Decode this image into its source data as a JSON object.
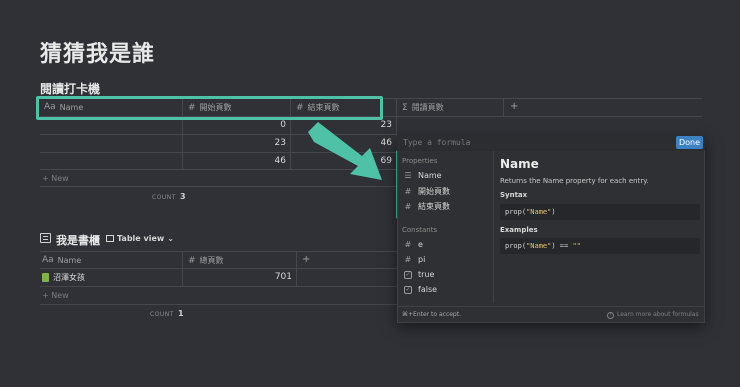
{
  "page": {
    "title": "猜猜我是誰"
  },
  "table1": {
    "title": "閱讀打卡機",
    "headers": {
      "name": "Name",
      "start": "開始頁數",
      "end": "結束頁數",
      "formula": "閱讀頁數",
      "add": "+"
    },
    "header_icons": {
      "name": "Aa",
      "num": "#",
      "formula": "Σ"
    },
    "rows": [
      {
        "start": "0",
        "end": "23"
      },
      {
        "start": "23",
        "end": "46"
      },
      {
        "start": "46",
        "end": "69"
      }
    ],
    "new_label": "+ New",
    "count_label": "COUNT",
    "count_value": "3"
  },
  "table2": {
    "icon": "book-icon",
    "title": "我是書櫃",
    "view": "Table view",
    "headers": {
      "name": "Name",
      "total": "總頁數",
      "add": "+"
    },
    "header_icons": {
      "name": "Aa",
      "num": "#"
    },
    "rows": [
      {
        "name": "沼澤女孩",
        "total": "701"
      }
    ],
    "new_label": "+ New",
    "count_label": "COUNT",
    "count_value": "1"
  },
  "formula": {
    "placeholder": "Type a formula",
    "done_label": "Done",
    "properties_label": "Properties",
    "properties": [
      {
        "icon": "text-icon",
        "glyph": "☰",
        "label": "Name"
      },
      {
        "icon": "hash-icon",
        "glyph": "#",
        "label": "開始頁數"
      },
      {
        "icon": "hash-icon",
        "glyph": "#",
        "label": "結束頁數"
      }
    ],
    "constants_label": "Constants",
    "constants": [
      {
        "icon": "hash-icon",
        "glyph": "#",
        "label": "e"
      },
      {
        "icon": "hash-icon",
        "glyph": "#",
        "label": "pi"
      },
      {
        "icon": "checkbox-icon",
        "glyph": "✓",
        "label": "true"
      },
      {
        "icon": "checkbox-icon",
        "glyph": "✓",
        "label": "false"
      }
    ],
    "detail": {
      "title": "Name",
      "description": "Returns the Name property for each entry.",
      "syntax_label": "Syntax",
      "syntax_pre": "prop(",
      "syntax_str": "\"Name\"",
      "syntax_post": ")",
      "examples_label": "Examples",
      "example_pre": "prop(",
      "example_str": "\"Name\"",
      "example_mid": ") == ",
      "example_str2": "\"\""
    },
    "footer_left": "⌘+Enter to accept.",
    "footer_right": "Learn more about formulas"
  },
  "colors": {
    "highlight": "#4fc1a6",
    "accent": "#3b82c4",
    "background": "#2f3136"
  }
}
